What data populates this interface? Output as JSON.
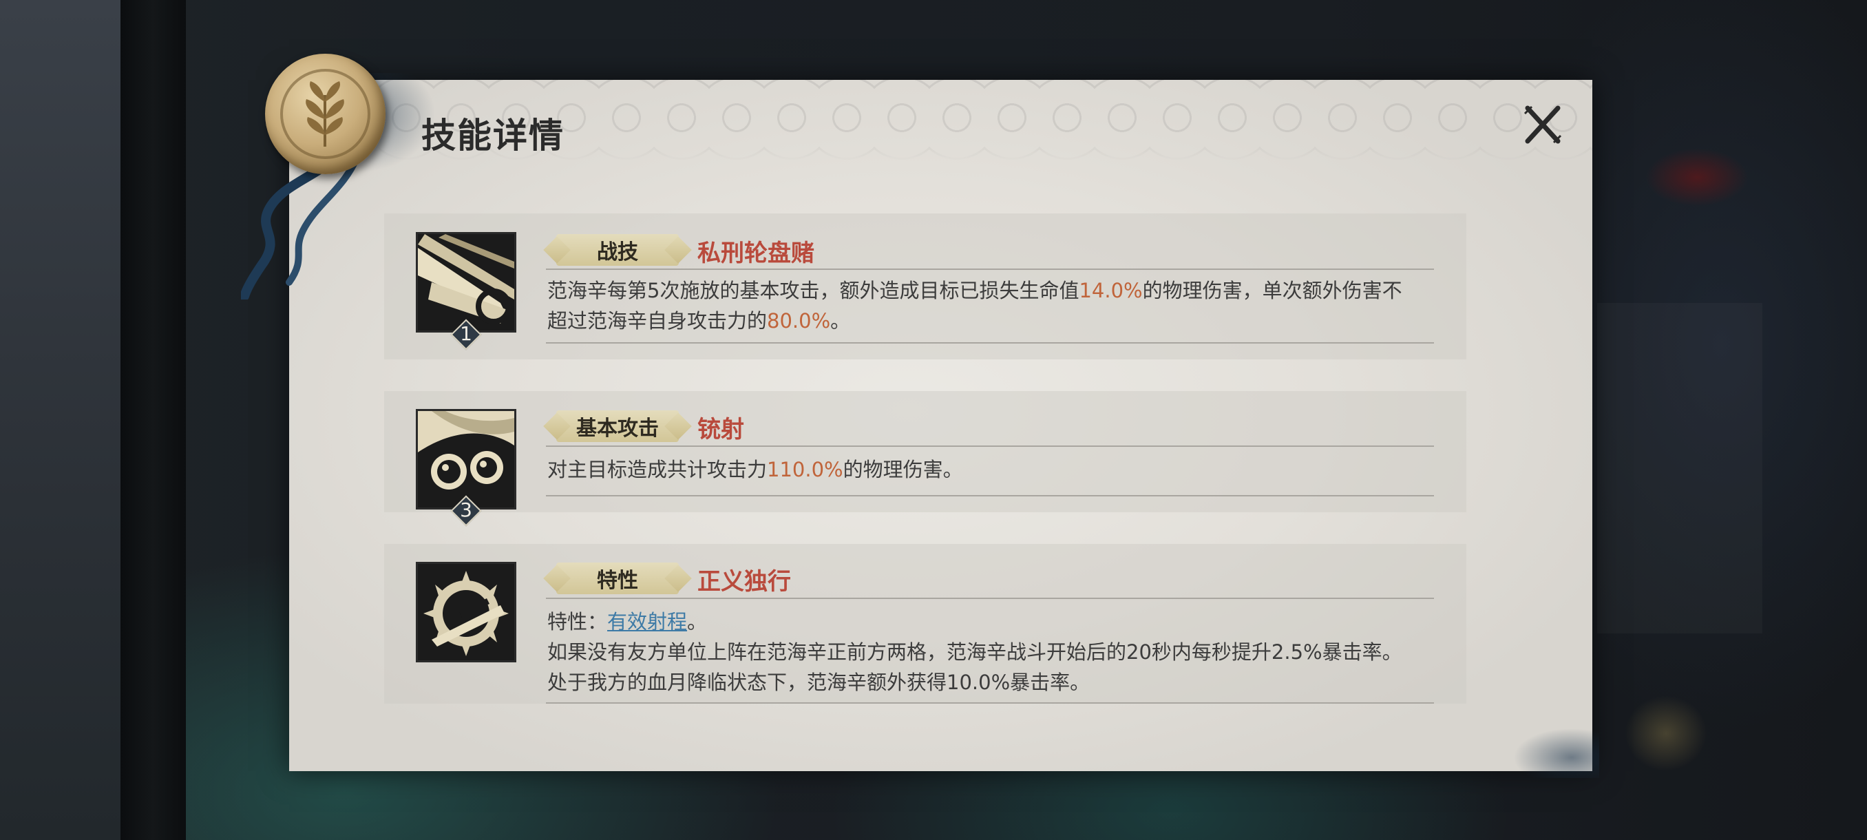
{
  "dialog": {
    "title": "技能详情",
    "close_icon": "close-x-icon"
  },
  "skills": [
    {
      "tag": "战技",
      "name": "私刑轮盘赌",
      "level": "1",
      "icon": "revolver-spin-icon",
      "desc_parts": [
        "范海辛每第5次施放的基本攻击，额外造成目标已损失生命值",
        "14.0%",
        "的物理伤害，单次额外伤害不",
        "超过范海辛自身攻击力的",
        "80.0%",
        "。"
      ]
    },
    {
      "tag": "基本攻击",
      "name": "铳射",
      "level": "3",
      "icon": "goggles-face-icon",
      "desc_parts": [
        "对主目标造成共计攻击力",
        "110.0%",
        "的物理伤害。"
      ]
    },
    {
      "tag": "特性",
      "name": "正义独行",
      "icon": "crossbow-emblem-icon",
      "line1_prefix": "特性：",
      "line1_link": "有效射程",
      "line1_suffix": "。",
      "line2": "如果没有友方单位上阵在范海辛正前方两格，范海辛战斗开始后的20秒内每秒提升2.5%暴击率。",
      "line3": "处于我方的血月降临状态下，范海辛额外获得10.0%暴击率。"
    }
  ],
  "colors": {
    "highlight": "#c0643a",
    "skill_name": "#b94a3c",
    "link": "#3d7aa6"
  }
}
